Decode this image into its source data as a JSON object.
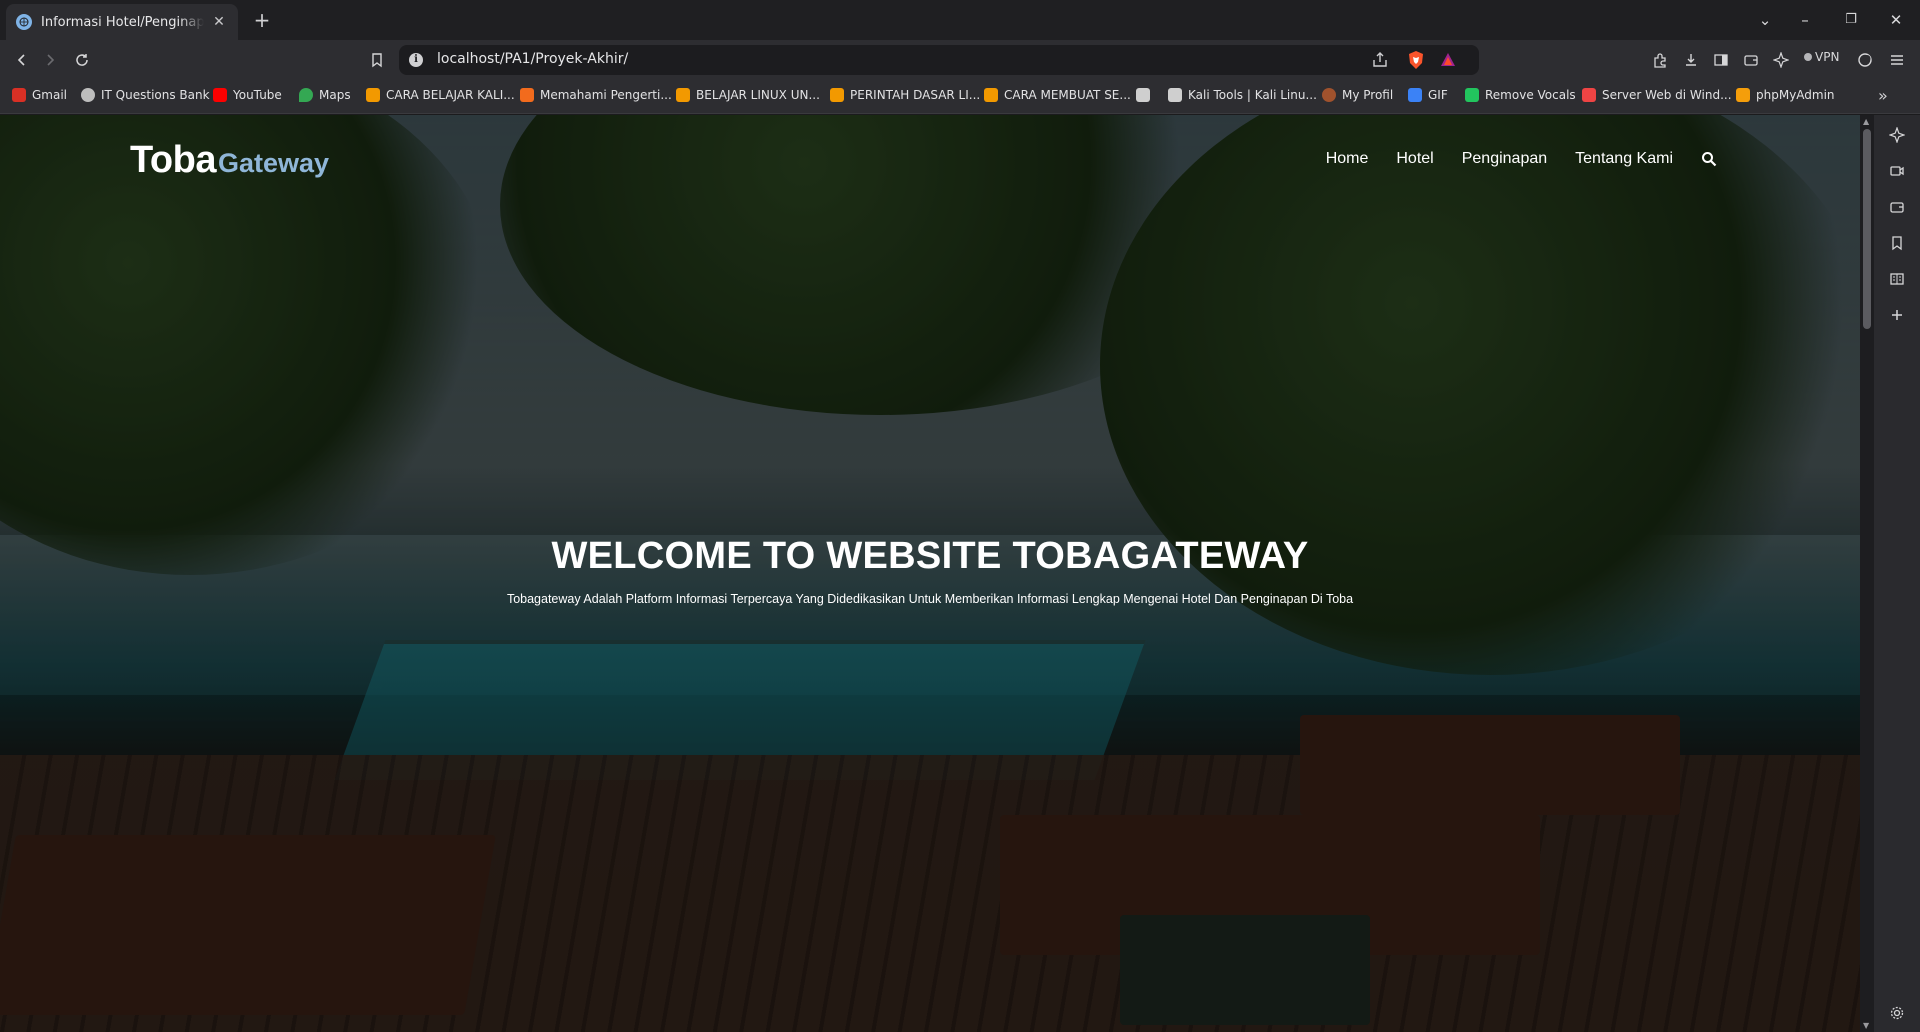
{
  "browser": {
    "tab_title": "Informasi Hotel/Penginapan/Te",
    "tab_close": "✕",
    "new_tab": "+",
    "window_controls": {
      "dropdown": "⌄",
      "minimize": "–",
      "restore": "❐",
      "close": "✕"
    },
    "url": "localhost/PA1/Proyek-Akhir/",
    "vpn_label": "VPN",
    "info_glyph": "i"
  },
  "bookmarks": [
    {
      "label": "Gmail",
      "icon": "gmail-icon",
      "color": "#d93025"
    },
    {
      "label": "IT Questions Bank",
      "icon": "globe-icon",
      "color": "#bdbdbd"
    },
    {
      "label": "YouTube",
      "icon": "youtube-icon",
      "color": "#ff0000"
    },
    {
      "label": "Maps",
      "icon": "maps-icon",
      "color": "#34a853"
    },
    {
      "label": "CARA BELAJAR KALI...",
      "icon": "blog-icon",
      "color": "#f29900"
    },
    {
      "label": "Memahami Pengerti...",
      "icon": "blog-icon",
      "color": "#f26b1d"
    },
    {
      "label": "BELAJAR LINUX UN...",
      "icon": "blog-icon",
      "color": "#f29900"
    },
    {
      "label": "PERINTAH DASAR LI...",
      "icon": "blog-icon",
      "color": "#f29900"
    },
    {
      "label": "CARA MEMBUAT SE...",
      "icon": "blog-icon",
      "color": "#f29900"
    },
    {
      "label": "",
      "icon": "kali-icon",
      "color": "#cfcfcf"
    },
    {
      "label": "Kali Tools | Kali Linu...",
      "icon": "kali-icon",
      "color": "#cfcfcf"
    },
    {
      "label": "My Profil",
      "icon": "profile-icon",
      "color": "#a0522d"
    },
    {
      "label": "GIF",
      "icon": "gif-icon",
      "color": "#3b82f6"
    },
    {
      "label": "Remove Vocals",
      "icon": "vocals-icon",
      "color": "#22c55e"
    },
    {
      "label": "Server Web di Wind...",
      "icon": "check-icon",
      "color": "#ef4444"
    },
    {
      "label": "phpMyAdmin",
      "icon": "phpmyadmin-icon",
      "color": "#f59e0b"
    }
  ],
  "bookmarks_more": "»",
  "site": {
    "logo_primary": "Toba",
    "logo_secondary": "Gateway",
    "nav": [
      "Home",
      "Hotel",
      "Penginapan",
      "Tentang Kami"
    ],
    "hero_title": "WELCOME TO WEBSITE TOBAGATEWAY",
    "hero_subtitle": "Tobagateway Adalah Platform Informasi Terpercaya Yang Didedikasikan Untuk Memberikan Informasi Lengkap Mengenai Hotel Dan Penginapan Di Toba"
  },
  "scrollbar": {
    "position_fraction": 0.0
  },
  "colors": {
    "logo_accent": "#8fb6d8",
    "chrome_bg": "#2d2d31",
    "tab_strip_bg": "#1f1f22"
  }
}
